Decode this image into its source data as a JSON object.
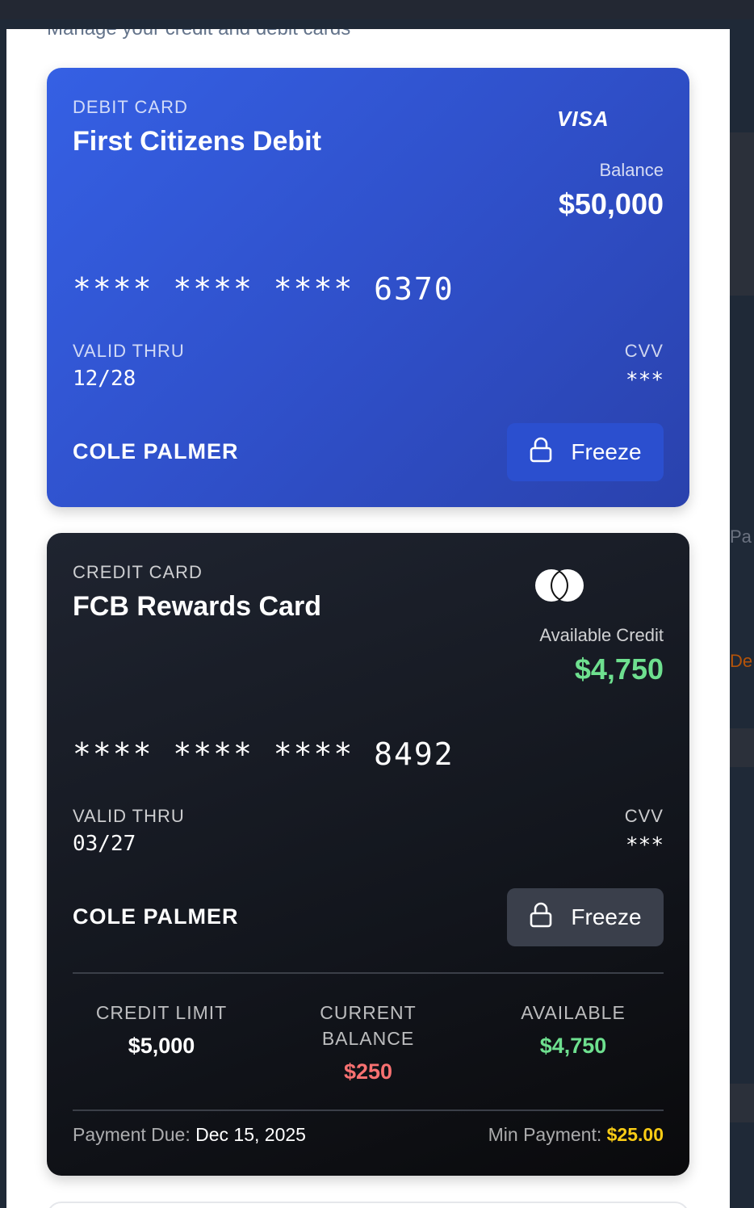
{
  "page": {
    "subtitle": "Manage your credit and debit cards"
  },
  "colors": {
    "debit_gradient_start": "#3560e4",
    "debit_gradient_end": "#2a42ad",
    "credit_gradient_start": "#1f2430",
    "credit_gradient_end": "#0a0a0c",
    "positive": "#6ee08f",
    "negative": "#f87171",
    "warning": "#facc15"
  },
  "background_peek": {
    "text_1": "Pa",
    "text_2": "De"
  },
  "debit_card": {
    "type_label": "DEBIT CARD",
    "name": "First Citizens Debit",
    "brand": "VISA",
    "balance_label": "Balance",
    "balance_value": "$50,000",
    "number": "**** **** **** 6370",
    "valid_label": "VALID THRU",
    "valid_value": "12/28",
    "cvv_label": "CVV",
    "cvv_value": "***",
    "holder": "COLE PALMER",
    "freeze_label": "Freeze",
    "freeze_icon": "lock-icon"
  },
  "credit_card": {
    "type_label": "CREDIT CARD",
    "name": "FCB Rewards Card",
    "brand": "mastercard-icon",
    "balance_label": "Available Credit",
    "balance_value": "$4,750",
    "number": "**** **** **** 8492",
    "valid_label": "VALID THRU",
    "valid_value": "03/27",
    "cvv_label": "CVV",
    "cvv_value": "***",
    "holder": "COLE PALMER",
    "freeze_label": "Freeze",
    "freeze_icon": "lock-icon",
    "stats": {
      "limit_label": "CREDIT LIMIT",
      "limit_value": "$5,000",
      "current_label_1": "CURRENT",
      "current_label_2": "BALANCE",
      "current_value": "$250",
      "available_label": "AVAILABLE",
      "available_value": "$4,750"
    },
    "payment_due_label": "Payment Due:",
    "payment_due_value": "Dec 15, 2025",
    "min_payment_label": "Min Payment:",
    "min_payment_value": "$25.00"
  }
}
